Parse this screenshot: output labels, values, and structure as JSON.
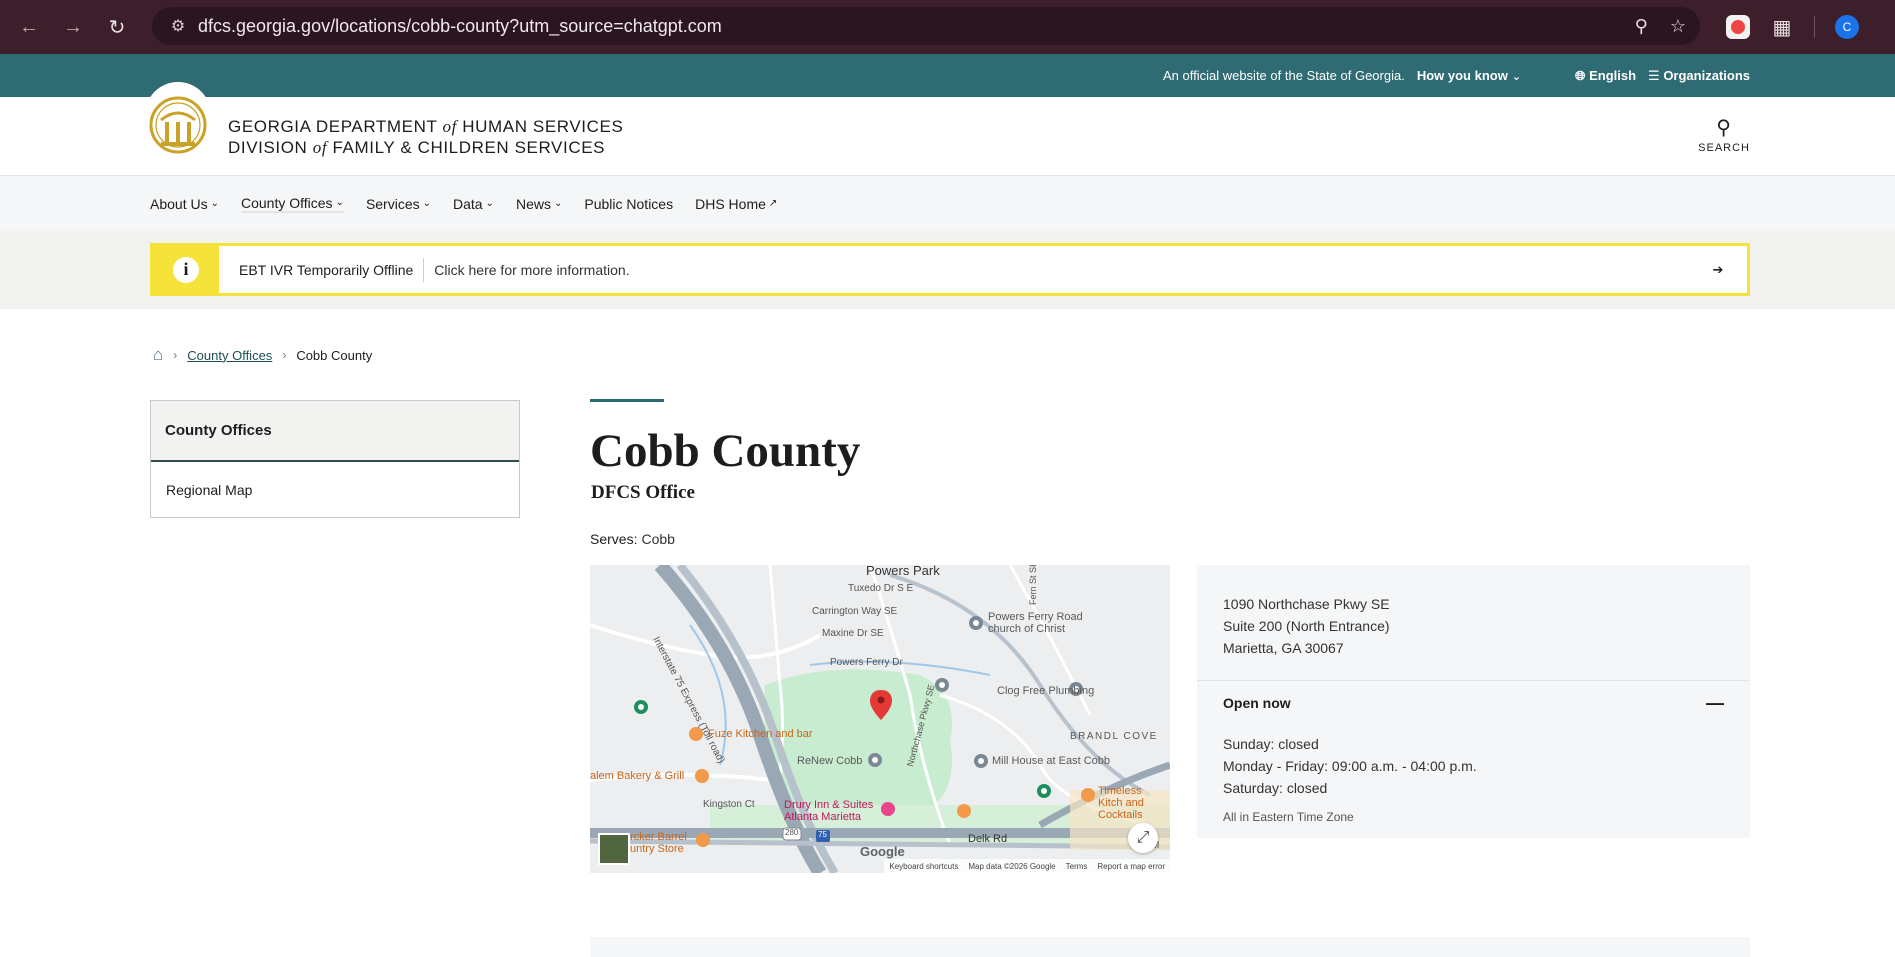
{
  "browser": {
    "url": "dfcs.georgia.gov/locations/cobb-county?utm_source=chatgpt.com",
    "profile_initial": "C"
  },
  "official_banner": {
    "statement": "An official website of the State of Georgia.",
    "how_you_know": "How you know",
    "language": "English",
    "organizations": "Organizations"
  },
  "header": {
    "line1_a": "GEORGIA DEPARTMENT ",
    "line1_of": "of",
    "line1_b": " HUMAN SERVICES",
    "line2_a": "DIVISION ",
    "line2_of": "of",
    "line2_b": " FAMILY & CHILDREN SERVICES",
    "search_label": "SEARCH"
  },
  "nav": {
    "items": [
      {
        "label": "About Us",
        "dropdown": true
      },
      {
        "label": "County Offices",
        "dropdown": true
      },
      {
        "label": "Services",
        "dropdown": true
      },
      {
        "label": "Data",
        "dropdown": true
      },
      {
        "label": "News",
        "dropdown": true
      },
      {
        "label": "Public Notices",
        "dropdown": false
      },
      {
        "label": "DHS Home",
        "dropdown": false
      }
    ]
  },
  "alert": {
    "title": "EBT IVR Temporarily Offline",
    "message": "Click here for more information."
  },
  "breadcrumb": {
    "parent": "County Offices",
    "current": "Cobb County"
  },
  "sidenav": {
    "heading": "County Offices",
    "items": [
      "Regional Map"
    ]
  },
  "page": {
    "title": "Cobb County",
    "subtitle": "DFCS Office",
    "serves_label": "Serves:",
    "serves_value": "Cobb"
  },
  "map": {
    "labels": {
      "powers_park": "Powers Park",
      "tuxedo": "Tuxedo Dr S E",
      "carrington": "Carrington Way SE",
      "maxine": "Maxine Dr SE",
      "powers_ferry_dr": "Powers Ferry Dr",
      "powers_ferry_road_church": "Powers Ferry Road church of Christ",
      "interstate": "Interstate 75 Express (Toll road)",
      "clog_free": "Clog Free Plumbing",
      "fuze": "Fuze Kitchen and bar",
      "brandl_cove": "BRANDL COVE",
      "renew_cobb": "ReNew Cobb",
      "mill_house": "Mill House at East Cobb",
      "salem": "alem Bakery & Grill",
      "kingston": "Kingston Ct",
      "drury": "Drury Inn & Suites Atlanta Marietta",
      "timeless": "Timeless Kitch and Cocktails",
      "cracker": "rcker Barrel untry Store",
      "delk": "Delk Rd",
      "google": "Google",
      "shortcuts": "Keyboard shortcuts",
      "mapdata": "Map data ©2026 Google",
      "terms": "Terms",
      "report": "Report a map error",
      "northchase": "Northchase Pkwy SE",
      "fern": "Fern St SE",
      "m_partial": "M",
      "route_280": "280",
      "route_75": "75"
    }
  },
  "office": {
    "address_line1": "1090 Northchase Pkwy SE",
    "address_line2": "Suite 200 (North Entrance)",
    "address_line3": "Marietta, GA 30067",
    "status": "Open now",
    "hours": [
      "Sunday: closed",
      "Monday - Friday: 09:00 a.m. - 04:00 p.m.",
      "Saturday: closed"
    ],
    "timezone_note": "All in Eastern Time Zone"
  },
  "colors": {
    "banner_teal": "#2e6b73",
    "alert_yellow": "#f5e33a",
    "chrome_bg": "#3c1f2b",
    "pin_red": "#e53935"
  }
}
